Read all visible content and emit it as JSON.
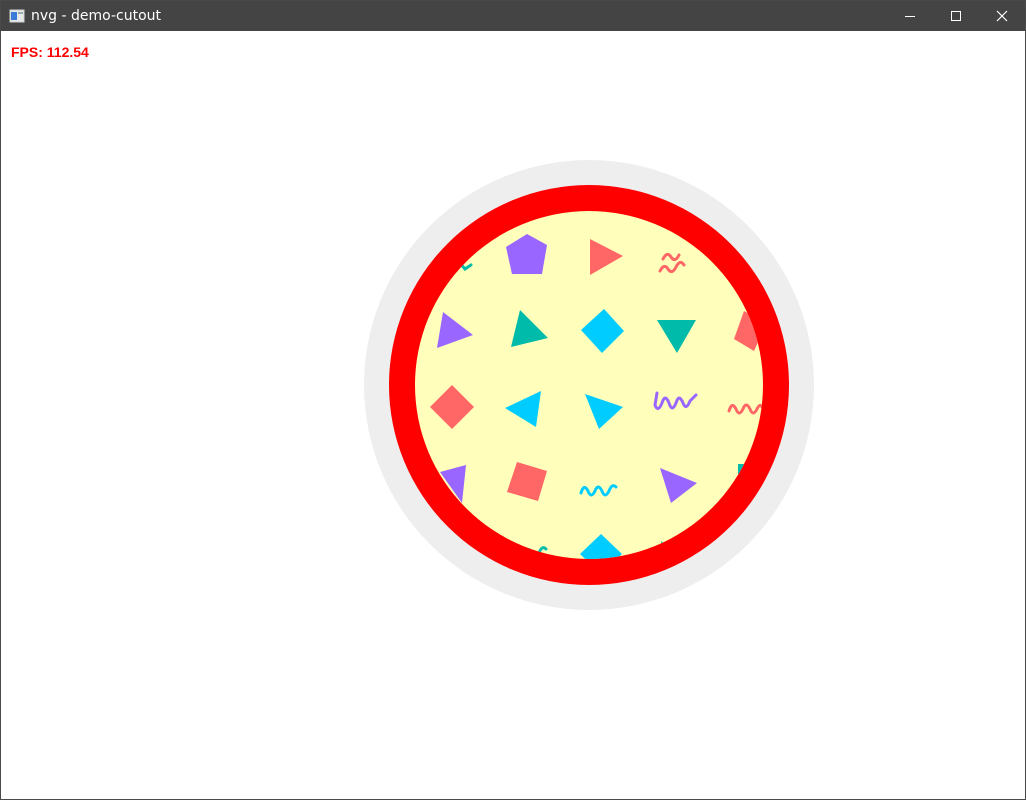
{
  "window": {
    "title": "nvg - demo-cutout",
    "controls": {
      "minimize": "minimize",
      "maximize": "maximize",
      "close": "close"
    }
  },
  "overlay": {
    "fps_text": "FPS: 112.54"
  },
  "colors": {
    "titlebar": "#444444",
    "fps_text": "#ff0000",
    "outer_ring": "#eeeeee",
    "red_ring": "#ff0000",
    "inner_fill": "#ffffbb",
    "purple": "#9966ff",
    "red_shape": "#ff6666",
    "teal": "#00bbaa",
    "cyan": "#00ccff"
  }
}
